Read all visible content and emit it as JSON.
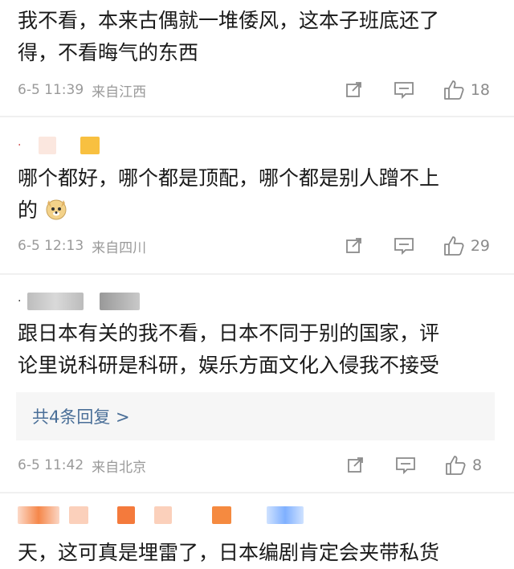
{
  "comments": [
    {
      "text_line1": "我不看，本来古偶就一堆倭风，这本子班底还了",
      "text_line2": "得，不看晦气的东西",
      "time": "6-5 11:39",
      "location": "来自江西",
      "likes": "18"
    },
    {
      "text_line1": "哪个都好，哪个都是顶配，哪个都是别人蹭不上",
      "text_line2": "的",
      "emoji": "doge-emoji",
      "time": "6-5 12:13",
      "location": "来自四川",
      "likes": "29"
    },
    {
      "text_line1": "跟日本有关的我不看，日本不同于别的国家，评",
      "text_line2": "论里说科研是科研，娱乐方面文化入侵我不接受",
      "replies": "共4条回复 >",
      "time": "6-5 11:42",
      "location": "来自北京",
      "likes": "8"
    },
    {
      "text_line1": "天，这可真是埋雷了，日本编剧肯定会夹带私货"
    }
  ],
  "icons": [
    "share-icon",
    "comment-icon",
    "like-icon"
  ],
  "colors": {
    "meta": "#9a9a9a",
    "reply_link": "#4a6f98",
    "text": "#1a1a1a"
  }
}
